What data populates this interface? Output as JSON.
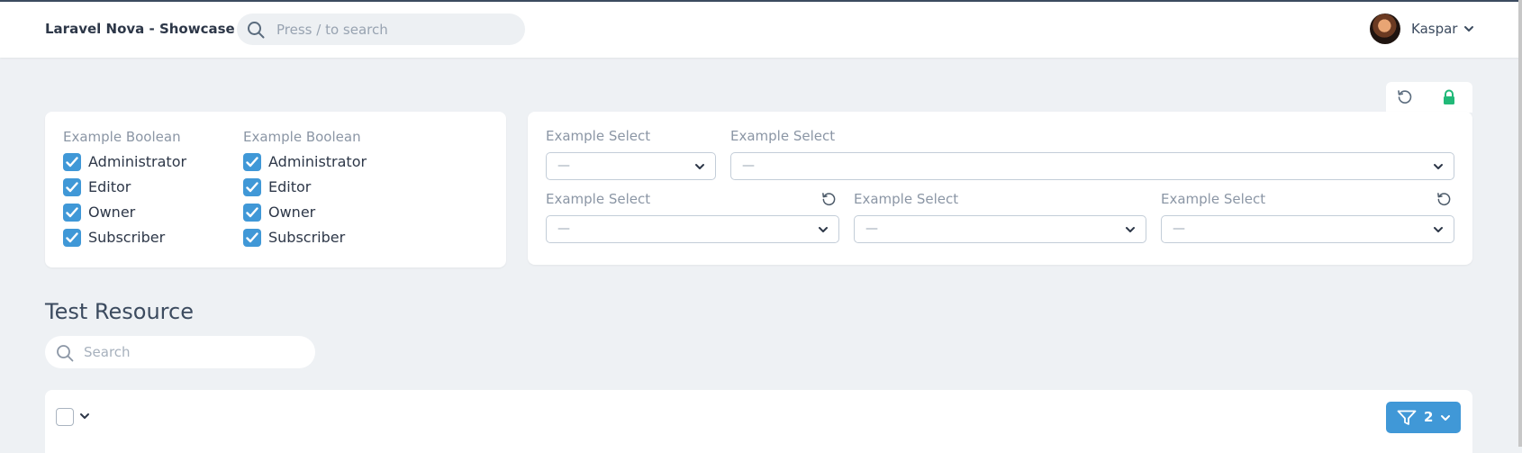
{
  "header": {
    "app_title": "Laravel Nova - Showcase",
    "search_placeholder": "Press / to search",
    "user_name": "Kaspar"
  },
  "boolean_card": {
    "columns": [
      {
        "label": "Example Boolean",
        "options": [
          {
            "label": "Administrator",
            "checked": true
          },
          {
            "label": "Editor",
            "checked": true
          },
          {
            "label": "Owner",
            "checked": true
          },
          {
            "label": "Subscriber",
            "checked": true
          }
        ]
      },
      {
        "label": "Example Boolean",
        "options": [
          {
            "label": "Administrator",
            "checked": true
          },
          {
            "label": "Editor",
            "checked": true
          },
          {
            "label": "Owner",
            "checked": true
          },
          {
            "label": "Subscriber",
            "checked": true
          }
        ]
      }
    ]
  },
  "select_card": {
    "selects": [
      {
        "label": "Example Select",
        "value": "—"
      },
      {
        "label": "Example Select",
        "value": "—"
      },
      {
        "label": "Example Select",
        "value": "—"
      },
      {
        "label": "Example Select",
        "value": "—"
      },
      {
        "label": "Example Select",
        "value": "—"
      }
    ]
  },
  "resource": {
    "title": "Test Resource",
    "search_placeholder": "Search",
    "filter_count": "2"
  },
  "colors": {
    "accent": "#4098d7",
    "lock": "#21b978",
    "background": "#eef1f4"
  },
  "icons": {
    "search": "search-icon",
    "reset": "reset-icon",
    "lock": "lock-icon",
    "filter": "filter-icon",
    "chevron": "chevron-down-icon"
  }
}
